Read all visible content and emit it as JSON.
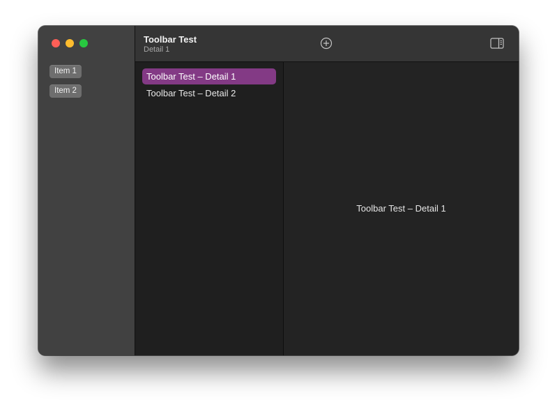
{
  "window": {
    "title": "Toolbar Test",
    "subtitle": "Detail 1"
  },
  "sidebar": {
    "items": [
      {
        "label": "Item 1"
      },
      {
        "label": "Item 2"
      }
    ]
  },
  "toolbar": {
    "add_icon": "plus-circle-icon",
    "panel_icon": "sidebar-right-icon"
  },
  "list": {
    "rows": [
      {
        "label": "Toolbar Test – Detail 1",
        "selected": true
      },
      {
        "label": "Toolbar Test – Detail 2",
        "selected": false
      }
    ]
  },
  "detail": {
    "text": "Toolbar Test – Detail 1"
  },
  "colors": {
    "selection": "#833a85",
    "sidebar_bg": "#414141",
    "toolbar_bg": "#353535",
    "content_bg": "#1f1f1f"
  }
}
